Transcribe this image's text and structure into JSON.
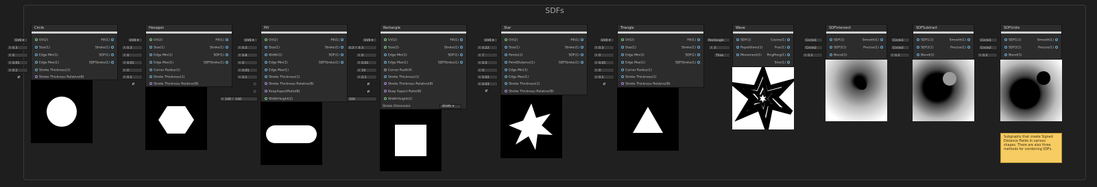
{
  "graph": {
    "title": "SDFs"
  },
  "nodes": {
    "circle": {
      "title": "Circle",
      "inputs": [
        "UV(2)",
        "Size(1)",
        "Edge Min(1)",
        "Edge Max(1)",
        "Stroke Thickness(1)",
        "Stroke Thickness Relative(B)"
      ],
      "outputs": [
        "Fill(1)",
        "Stroke(1)",
        "SDF(1)",
        "SDFStroke(1)"
      ],
      "values": [
        "UV0",
        "0.3",
        "0",
        "0.01",
        "0.1"
      ]
    },
    "hexagon": {
      "title": "Hexagon",
      "inputs": [
        "UV(2)",
        "Size(1)",
        "Edge Min(1)",
        "Edge Max(1)",
        "Corner Radius(1)",
        "Stroke Thickness(1)",
        "Stroke Thickness Relative(B)"
      ],
      "outputs": [
        "Fill(1)",
        "Stroke(1)",
        "SDF(1)",
        "SDFStroke(1)"
      ],
      "values": [
        "UV0",
        "0.3",
        "0",
        "0.01",
        "0",
        "0.1"
      ]
    },
    "pill": {
      "title": "Pill",
      "inputs": [
        "UV(2)",
        "Size(1)",
        "Width(1)",
        "Edge Min(1)",
        "Edge Max(1)",
        "Stroke Thickness(1)",
        "Stroke Thickness Relative(B)",
        "KeepAspectRatio(B)",
        "WidthHeight(2)"
      ],
      "outputs": [
        "Fill(1)",
        "Stroke(1)",
        "SDF(1)",
        "SDFStroke(1)"
      ],
      "values": [
        "UV0",
        "0.3",
        "0.8",
        "0",
        "0.01",
        "0.1"
      ],
      "wh": [
        "100",
        "100"
      ]
    },
    "rectangle": {
      "title": "Rectangle",
      "inputs": [
        "UV(2)",
        "Size(2)",
        "Edge Min(1)",
        "Edge Max(1)",
        "Corner Radii(4)",
        "Stroke Thickness(1)",
        "Stroke Thickness Relative(B)",
        "Keep Aspect Ratio(B)",
        "WidthHeight(2)"
      ],
      "outputs": [
        "Fill(1)",
        "Stroke(1)",
        "SDF(1)",
        "SDFStroke(1)"
      ],
      "values": [
        "UV0",
        "0.3",
        "0",
        "0.01",
        "10",
        "0.1"
      ],
      "size_y": "0.3",
      "wh": "100",
      "dimension_label": "Stroke Dimension",
      "dimension_value": "Width"
    },
    "star": {
      "title": "Star",
      "inputs": [
        "UV(2)",
        "Size(1)",
        "Points(1)",
        "PointDistance(1)",
        "Edge Min(1)",
        "Edge Max(1)",
        "Stroke Thickness(1)",
        "Stroke Thickness Relative(B)"
      ],
      "outputs": [
        "Fill(1)",
        "Stroke(1)",
        "SDF(1)",
        "SDFStroke(1)"
      ],
      "values": [
        "UV0",
        "0.22",
        "7",
        "0.5",
        "0",
        "0.02",
        "0.03"
      ]
    },
    "triangle": {
      "title": "Triangle",
      "inputs": [
        "UV(2)",
        "Size(1)",
        "Edge Min(1)",
        "Edge Max(1)",
        "Corner Radius(1)",
        "Stroke Thickness(1)",
        "Stroke Thickness Relative(B)"
      ],
      "outputs": [
        "Fill(1)",
        "Stroke(1)",
        "SDF(1)",
        "SDFStroke(1)"
      ],
      "values": [
        "UV0",
        "0.3",
        "0",
        "0.01",
        "0",
        "0.1"
      ]
    },
    "wave": {
      "title": "Wave",
      "inputs": [
        "SDF(1)",
        "Repetitions(1)",
        "Movement(1)"
      ],
      "outputs": [
        "Cosine(1)",
        "Frac(1)",
        "PingPong(1)",
        "Sine(1)"
      ],
      "values": [
        "Rectangle",
        "3",
        "Time"
      ]
    },
    "intersect": {
      "title": "SDFIntersect",
      "inputs": [
        "SDF(1)",
        "SDF2(1)",
        "Blend(1)"
      ],
      "outputs": [
        "Smooth(1)",
        "Precise(1)"
      ],
      "values": [
        "Circle1",
        "Circle2",
        "0.2"
      ]
    },
    "subtract": {
      "title": "SDFSubtract",
      "inputs": [
        "SDF1(1)",
        "SDF2(1)",
        "Blend(1)"
      ],
      "outputs": [
        "Smooth(1)",
        "Precise(1)"
      ],
      "values": [
        "Circle1",
        "Circle2",
        "0.2"
      ]
    },
    "unite": {
      "title": "SDFUnite",
      "inputs": [
        "SDF1(1)",
        "SDF2(1)",
        "Blend(1)"
      ],
      "outputs": [
        "Smooth(1)",
        "Precise(1)"
      ],
      "values": [
        "Circle1",
        "Circle2",
        "0.2"
      ]
    }
  },
  "note": {
    "text": "Subgraphs that create Signed Distance Fields in various shapes. There are also three methods for combining SDFs."
  },
  "colors": {
    "background": "#1e1e1e",
    "node": "#2c2c2c",
    "port_float": "#6ab0d8",
    "port_vec": "#7fd08a",
    "port_bool": "#b18ae0",
    "note": "#f6cc63"
  }
}
